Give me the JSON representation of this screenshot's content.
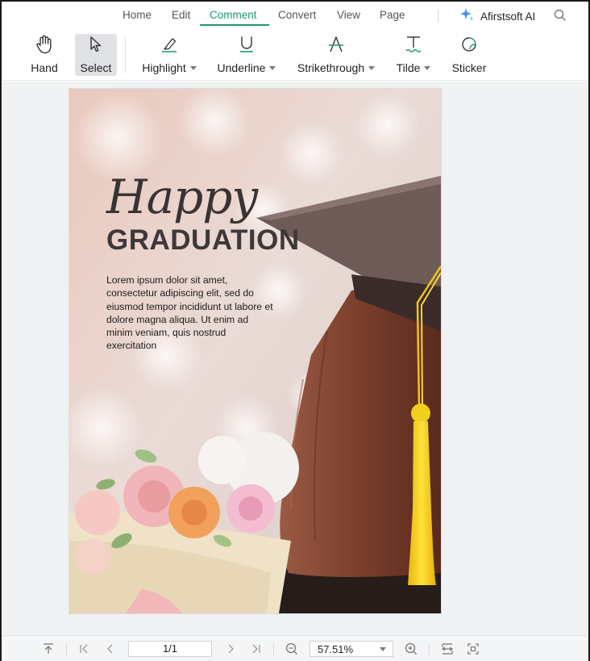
{
  "menu": {
    "items": [
      {
        "label": "Home"
      },
      {
        "label": "Edit"
      },
      {
        "label": "Comment"
      },
      {
        "label": "Convert"
      },
      {
        "label": "View"
      },
      {
        "label": "Page"
      }
    ],
    "active": "Comment",
    "ai_label": "Afirstsoft AI"
  },
  "toolbar": {
    "tools": [
      {
        "label": "Hand",
        "icon": "hand-icon"
      },
      {
        "label": "Select",
        "icon": "cursor-icon",
        "selected": true
      },
      {
        "label": "Highlight",
        "icon": "highlight-icon",
        "has_dropdown": true
      },
      {
        "label": "Underline",
        "icon": "underline-icon",
        "has_dropdown": true
      },
      {
        "label": "Strikethrough",
        "icon": "strikethrough-icon",
        "has_dropdown": true
      },
      {
        "label": "Tilde",
        "icon": "tilde-icon",
        "has_dropdown": true
      },
      {
        "label": "Sticker",
        "icon": "sticker-icon"
      }
    ]
  },
  "document": {
    "title_script": "Happy",
    "title_bold": "GRADUATION",
    "body_lines": [
      "Lorem ipsum dolor sit amet,",
      "consectetur adipiscing elit, sed do",
      "eiusmod tempor incididunt ut labore et",
      "dolore magna aliqua. Ut enim ad",
      "minim veniam, quis nostrud",
      "exercitation"
    ]
  },
  "pager": {
    "page_value": "1/1",
    "zoom_value": "57.51%"
  },
  "colors": {
    "accent": "#1e9a6a",
    "tassel": "#f2cf1d",
    "cap": "#6e5a57",
    "hair": "#7a4130"
  }
}
